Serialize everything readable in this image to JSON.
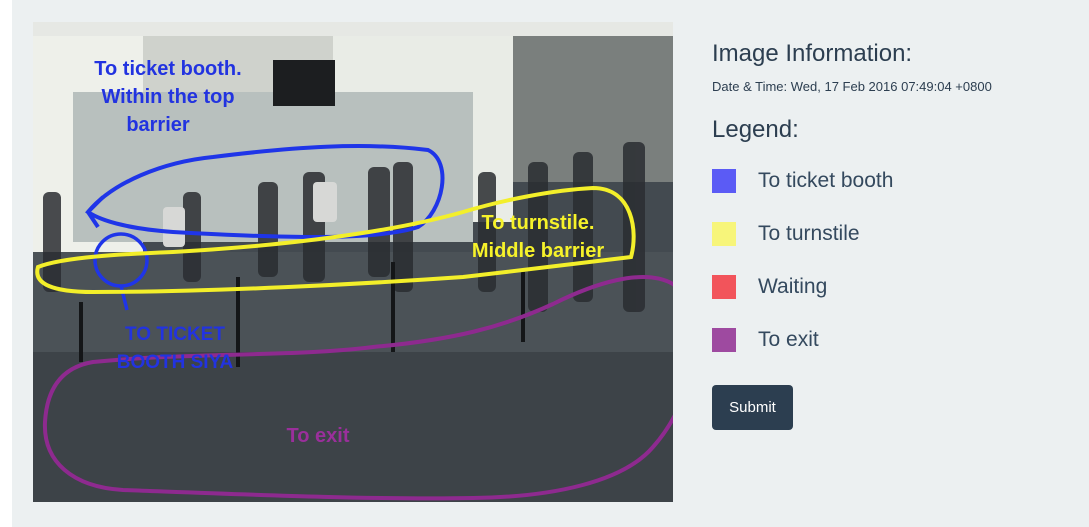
{
  "image_panel": {
    "annotations": {
      "ticket_booth_note": [
        "To ticket booth.",
        "Within the top",
        "barrier"
      ],
      "turnstile_note": [
        "To turnstile.",
        "Middle barrier"
      ],
      "ticket_booth_siya_note": [
        "TO TICKET",
        "BOOTH SIYA"
      ],
      "exit_note": "To exit"
    }
  },
  "info": {
    "title": "Image Information:",
    "datetime": "Date & Time: Wed, 17 Feb 2016 07:49:04 +0800",
    "legend_title": "Legend:",
    "legend": [
      {
        "label": "To ticket booth",
        "color": "#5b5bf5"
      },
      {
        "label": "To turnstile",
        "color": "#f7f57a"
      },
      {
        "label": "Waiting",
        "color": "#f2545b"
      },
      {
        "label": "To exit",
        "color": "#9e4aa0"
      }
    ]
  },
  "submit_label": "Submit"
}
